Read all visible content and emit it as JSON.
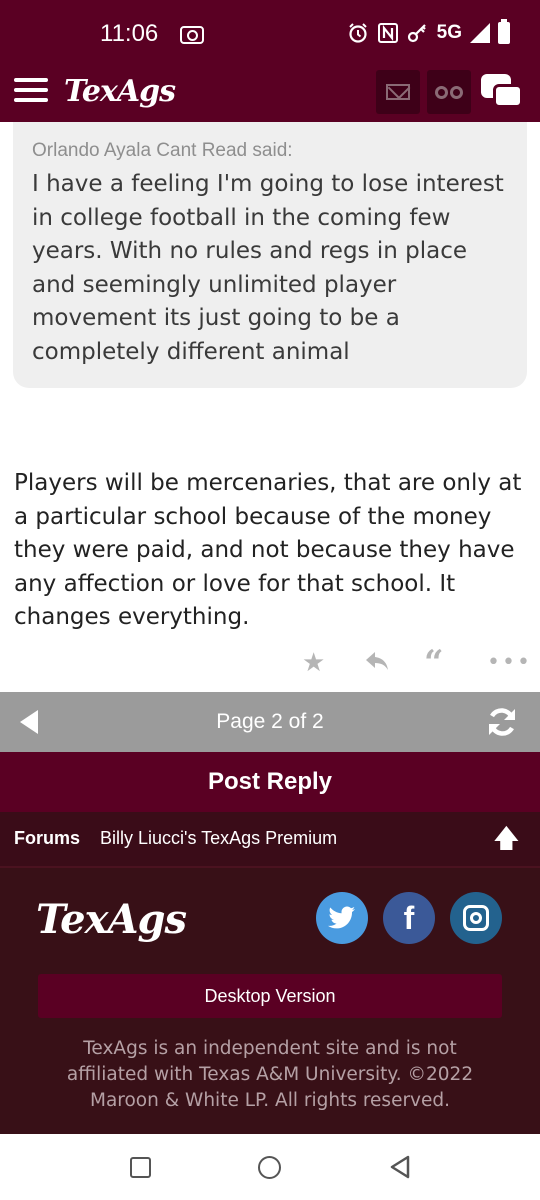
{
  "status_bar": {
    "time": "11:06",
    "network": "5G",
    "icons": [
      "screen-record-icon",
      "alarm-icon",
      "nfc-icon",
      "key-icon",
      "signal-icon",
      "battery-icon"
    ]
  },
  "header": {
    "logo_text": "TexAgs",
    "icons": [
      "menu-icon",
      "mail-icon",
      "binoculars-icon",
      "chat-icon"
    ]
  },
  "quote": {
    "author": "Orlando Ayala Cant Read said:",
    "text": "I have a feeling I'm going to lose interest in college football in the coming few years. With no rules and regs in place and seemingly unlimited player movement its just going to be a completely different animal"
  },
  "post": {
    "body": "Players will be mercenaries, that are only at a particular school because of the money they were paid, and not because they have any affection or love for that school. It changes everything.",
    "actions": [
      "star-icon",
      "reply-icon",
      "quote-icon",
      "more-icon"
    ]
  },
  "pager": {
    "label": "Page 2 of 2"
  },
  "post_reply_label": "Post Reply",
  "breadcrumb": {
    "root": "Forums",
    "forum": "Billy Liucci's TexAgs Premium"
  },
  "footer": {
    "logo_text": "TexAgs",
    "desktop_label": "Desktop Version",
    "disclaimer": "TexAgs is an independent site and is not affiliated with Texas A&M University. ©2022 Maroon & White LP. All rights reserved.",
    "social": [
      "twitter-icon",
      "facebook-icon",
      "instagram-icon"
    ]
  },
  "colors": {
    "maroon": "#5a0023",
    "footer_bg": "#381017",
    "pager_gray": "#9b9b9b",
    "twitter": "#4a9be0",
    "facebook": "#3b5998",
    "instagram": "#23628e"
  }
}
